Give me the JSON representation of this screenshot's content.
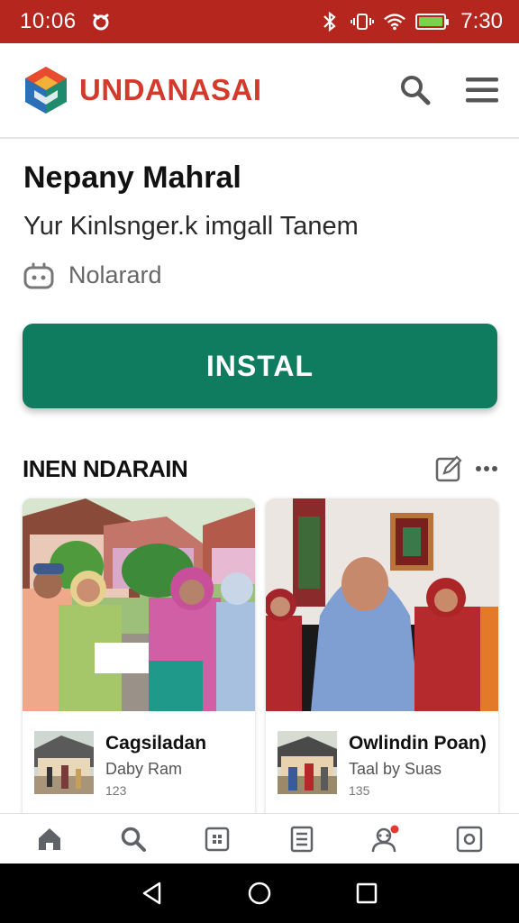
{
  "status_bar": {
    "time_left": "10:06",
    "time_right": "7:30",
    "icons": [
      "alert-icon",
      "bluetooth-icon",
      "vibrate-icon",
      "wifi-icon",
      "battery-icon"
    ],
    "bar_color": "#b5261e"
  },
  "header": {
    "brand": "UNDANASAI",
    "brand_color": "#d23a2c",
    "actions": [
      "search-icon",
      "menu-icon"
    ]
  },
  "profile": {
    "name": "Nepany Mahral",
    "subtitle": "Yur Kinlsnger.k imgall Tanem",
    "meta_label": "Nolarard",
    "meta_icon": "bot-icon"
  },
  "install_button": {
    "label": "INSTAL",
    "color": "#0f7b5f"
  },
  "section": {
    "title": "INEN NDARAIN",
    "actions": [
      "edit-icon",
      "more-icon"
    ]
  },
  "cards": [
    {
      "title": "Cagsiladan",
      "subtitle": "Daby Ram",
      "count": "123"
    },
    {
      "title": "Owlindin Poan)",
      "subtitle": "Taal by Suas",
      "count": "135"
    }
  ],
  "bottom_nav": {
    "items": [
      "home-icon",
      "search-icon",
      "grid-icon",
      "document-icon",
      "community-icon",
      "settings-icon"
    ],
    "active": "home-icon"
  },
  "system_nav": [
    "back-icon",
    "home-circle-icon",
    "recents-icon"
  ]
}
